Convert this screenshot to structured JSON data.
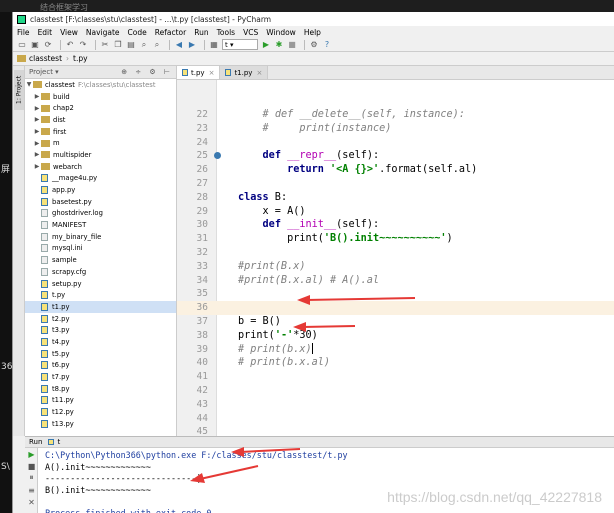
{
  "window": {
    "title": "classtest [F:\\classes\\stu\\classtest] - ...\\t.py [classtest] - PyCharm"
  },
  "menu": [
    "File",
    "Edit",
    "View",
    "Navigate",
    "Code",
    "Refactor",
    "Run",
    "Tools",
    "VCS",
    "Window",
    "Help"
  ],
  "toolbar": {
    "run_config": "t"
  },
  "breadcrumb": {
    "project": "classtest",
    "file": "t.py"
  },
  "project_panel": {
    "header": "Project",
    "root": {
      "name": "classtest",
      "path": "F:\\classes\\stu\\classtest"
    },
    "folders": [
      "build",
      "chap2",
      "dist",
      "first",
      "m",
      "multispider",
      "webarch"
    ],
    "files": [
      "__mage4u.py",
      "app.py",
      "basetest.py",
      "ghostdriver.log",
      "MANIFEST",
      "my_binary_file",
      "mysql.ini",
      "sample",
      "scrapy.cfg",
      "setup.py",
      "t.py",
      "t1.py",
      "t2.py",
      "t3.py",
      "t4.py",
      "t5.py",
      "t6.py",
      "t7.py",
      "t8.py",
      "t11.py",
      "t12.py",
      "t13.py"
    ],
    "selected": "t1.py"
  },
  "tabs": [
    {
      "label": "t.py",
      "active": true
    },
    {
      "label": "t1.py",
      "active": false
    }
  ],
  "code": [
    {
      "n": "22",
      "text": "    # def __delete__(self, instance):"
    },
    {
      "n": "23",
      "text": "    #     print(instance)"
    },
    {
      "n": "24",
      "text": ""
    },
    {
      "n": "25",
      "text": "    def __repr__(self):"
    },
    {
      "n": "26",
      "text": "        return '<A {}>'.format(self.al)"
    },
    {
      "n": "27",
      "text": ""
    },
    {
      "n": "28",
      "text": "class B:"
    },
    {
      "n": "29",
      "text": "    x = A()"
    },
    {
      "n": "30",
      "text": "    def __init__(self):"
    },
    {
      "n": "31",
      "text": "        print('B().init~~~~~~~~~~')"
    },
    {
      "n": "32",
      "text": ""
    },
    {
      "n": "33",
      "text": "#print(B.x)"
    },
    {
      "n": "34",
      "text": "#print(B.x.al) # A().al"
    },
    {
      "n": "35",
      "text": ""
    },
    {
      "n": "36",
      "text": ""
    },
    {
      "n": "37",
      "text": "b = B()"
    },
    {
      "n": "38",
      "text": "print('-'*30)"
    },
    {
      "n": "39",
      "text": "# print(b.x)"
    },
    {
      "n": "40",
      "text": "# print(b.x.al)"
    },
    {
      "n": "41",
      "text": ""
    },
    {
      "n": "42",
      "text": ""
    },
    {
      "n": "43",
      "text": ""
    },
    {
      "n": "44",
      "text": ""
    },
    {
      "n": "45",
      "text": ""
    }
  ],
  "run_panel": {
    "label": "Run",
    "config": "t",
    "lines": [
      "C:\\Python\\Python366\\python.exe F:/classes/stu/classtest/t.py",
      "A().init~~~~~~~~~~~~~",
      "------------------------------|",
      "B().init~~~~~~~~~~~~~",
      "",
      "Process finished with exit code 0"
    ]
  },
  "watermark": "https://blog.csdn.net/qq_42227818",
  "left_edge_text": [
    "屏",
    "36",
    "S\\"
  ],
  "outer_top_text": "结合框架学习",
  "accent_colors": {
    "keyword": "#000080",
    "string": "#008000",
    "comment": "#808080",
    "annotation_arrow": "#e53935"
  }
}
